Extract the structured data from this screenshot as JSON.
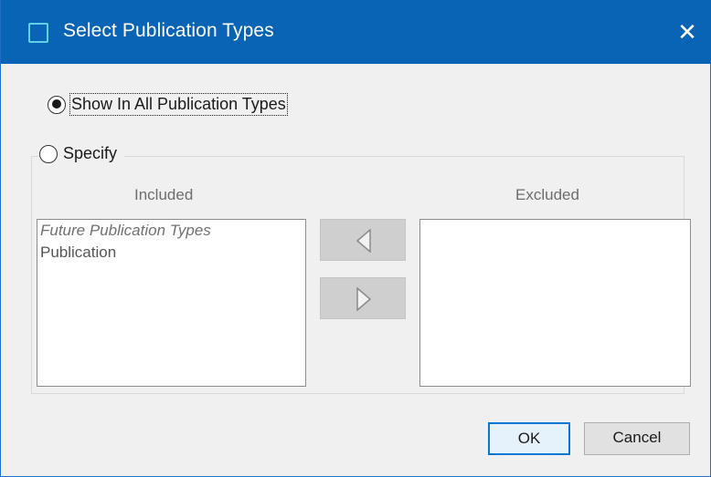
{
  "dialog": {
    "title": "Select Publication Types",
    "close_glyph": "✕"
  },
  "options": {
    "show_all_label": "Show In All Publication Types",
    "show_all_selected": true,
    "specify_label": "Specify",
    "specify_selected": false
  },
  "included": {
    "header": "Included",
    "items": [
      "Future Publication Types",
      "Publication"
    ]
  },
  "excluded": {
    "header": "Excluded",
    "items": []
  },
  "transfer": {
    "left_icon": "triangle-left-icon",
    "right_icon": "triangle-right-icon"
  },
  "buttons": {
    "ok_label": "OK",
    "cancel_label": "Cancel"
  },
  "colors": {
    "titlebar": "#0a64b5",
    "default_button_border": "#0078d7"
  }
}
